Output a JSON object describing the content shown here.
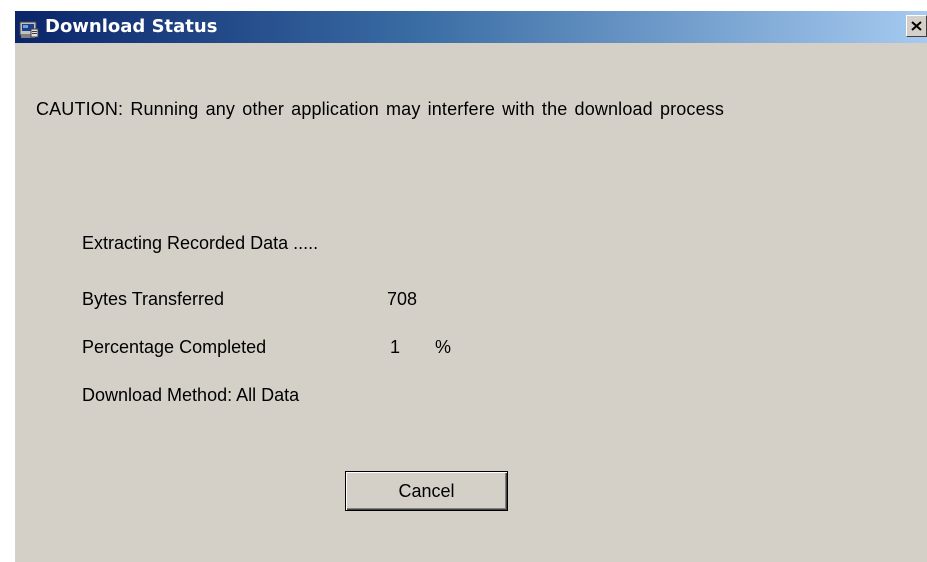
{
  "window": {
    "title": "Download Status",
    "icon": "app-icon",
    "close_icon": "close-icon"
  },
  "caution": "CAUTION: Running any other application may interfere with the download process",
  "status": {
    "extracting": "Extracting Recorded Data .....",
    "bytes_label": "Bytes Transferred",
    "bytes_value": "708",
    "percentage_label": "Percentage Completed",
    "percentage_value": "1",
    "percentage_unit": "%",
    "method": "Download Method: All Data"
  },
  "buttons": {
    "cancel": "Cancel"
  },
  "colors": {
    "titlebar_start": "#0a246a",
    "titlebar_end": "#a6caf0",
    "face": "#d4d0c8"
  }
}
